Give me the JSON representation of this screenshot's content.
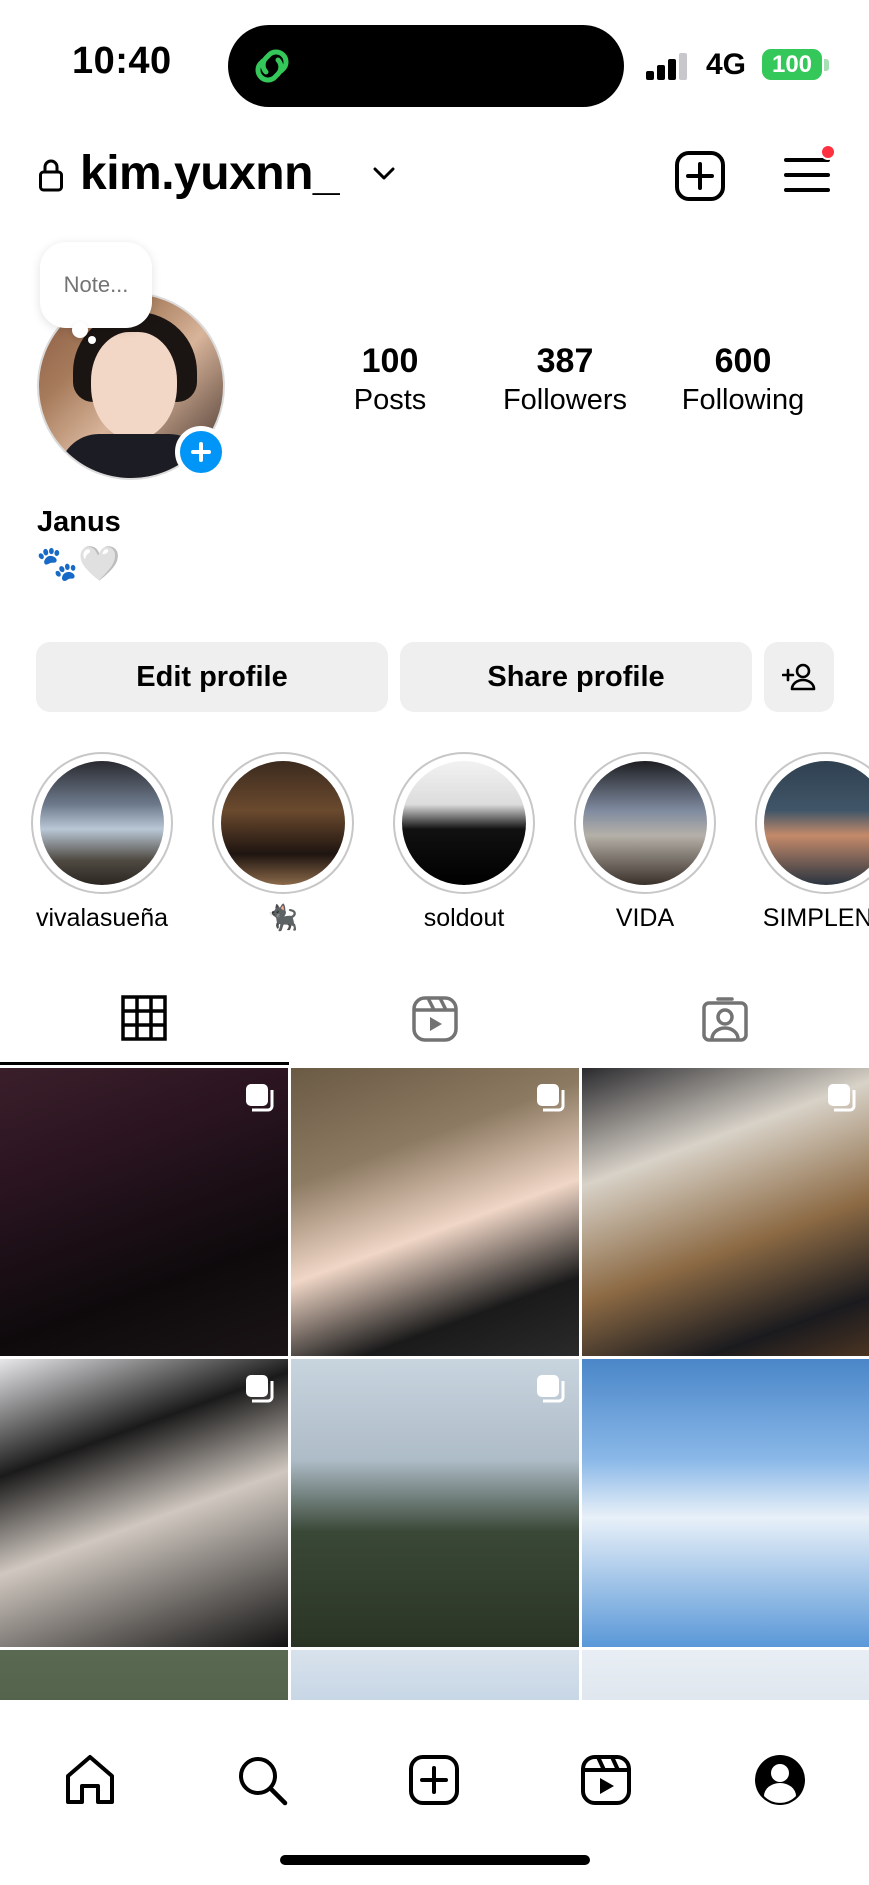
{
  "status_bar": {
    "time": "10:40",
    "network": "4G",
    "battery": "100"
  },
  "header": {
    "username": "kim.yuxnn_"
  },
  "profile": {
    "note_placeholder": "Note...",
    "stats": [
      {
        "value": "100",
        "label": "Posts"
      },
      {
        "value": "387",
        "label": "Followers"
      },
      {
        "value": "600",
        "label": "Following"
      }
    ],
    "full_name": "Janus",
    "bio": "🐾🤍"
  },
  "actions": {
    "edit_label": "Edit profile",
    "share_label": "Share profile"
  },
  "highlights": [
    {
      "label": "vivalasueña"
    },
    {
      "label": "🐈‍⬛"
    },
    {
      "label": "soldout"
    },
    {
      "label": "VIDA"
    },
    {
      "label": "SIMPLENE"
    }
  ],
  "tabs": [
    {
      "icon": "grid-icon",
      "active": true
    },
    {
      "icon": "reels-icon",
      "active": false
    },
    {
      "icon": "tagged-icon",
      "active": false
    }
  ],
  "bottom_nav": [
    {
      "icon": "home-icon"
    },
    {
      "icon": "search-icon"
    },
    {
      "icon": "create-icon"
    },
    {
      "icon": "reels-icon"
    },
    {
      "icon": "profile-icon"
    }
  ],
  "colors": {
    "accent": "#0095f6",
    "battery": "#34c759",
    "notification": "#ff3040",
    "button_bg": "#efefef"
  }
}
